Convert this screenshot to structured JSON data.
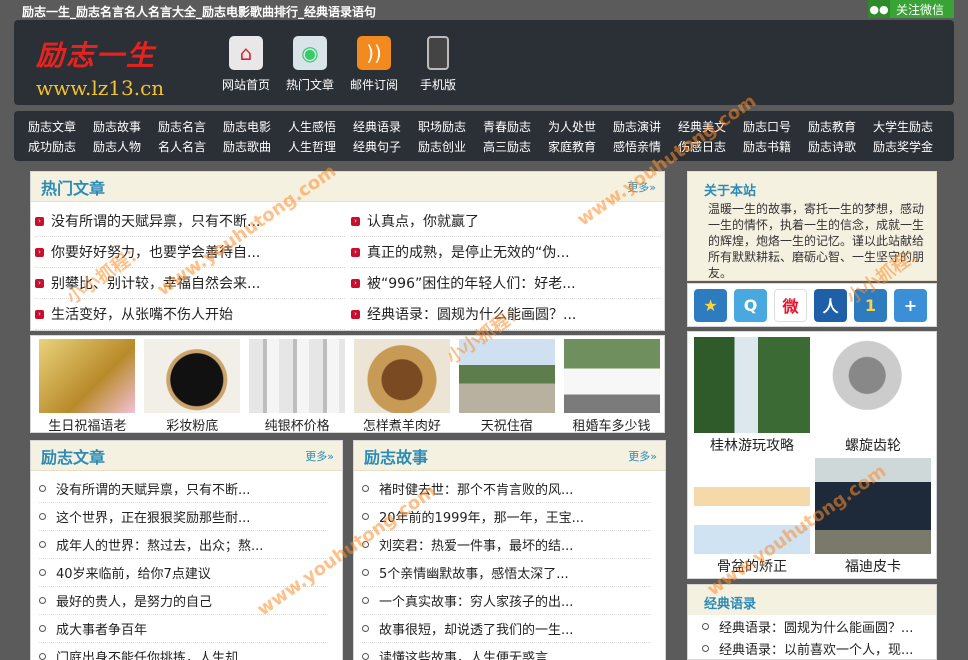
{
  "topbar": {
    "title": "励志一生_励志名言名人名言大全_励志电影歌曲排行_经典语录语句",
    "wechat": "关注微信"
  },
  "header": {
    "logo_cn": "励志一生",
    "logo_url": "www.lz13.cn",
    "nav": [
      {
        "label": "网站首页",
        "icon": "home-icon"
      },
      {
        "label": "热门文章",
        "icon": "globe-doc-icon"
      },
      {
        "label": "邮件订阅",
        "icon": "rss-icon"
      },
      {
        "label": "手机版",
        "icon": "phone-icon"
      }
    ]
  },
  "categories": {
    "row1": [
      "励志文章",
      "励志故事",
      "励志名言",
      "励志电影",
      "人生感悟",
      "经典语录",
      "职场励志",
      "青春励志",
      "为人处世",
      "励志演讲",
      "经典美文",
      "励志口号",
      "励志教育",
      "大学生励志"
    ],
    "row2": [
      "成功励志",
      "励志人物",
      "名人名言",
      "励志歌曲",
      "人生哲理",
      "经典句子",
      "励志创业",
      "高三励志",
      "家庭教育",
      "感悟亲情",
      "伤感日志",
      "励志书籍",
      "励志诗歌",
      "励志奖学金"
    ]
  },
  "hot": {
    "title": "热门文章",
    "more": "更多»",
    "items": [
      "没有所谓的天赋异禀，只有不断...",
      "认真点，你就赢了",
      "你要好好努力，也要学会善待自...",
      "真正的成熟，是停止无效的“伪...",
      "别攀比、别计较，幸福自然会来...",
      "被“996”困住的年轻人们：好老...",
      "生活变好，从张嘴不伤人开始",
      "经典语录：圆规为什么能画圆？..."
    ]
  },
  "photos": [
    "生日祝福语老",
    "彩妆粉底",
    "纯银杯价格",
    "怎样煮羊肉好",
    "天祝住宿",
    "租婚车多少钱"
  ],
  "lizhi": {
    "title": "励志文章",
    "more": "更多»",
    "items": [
      "没有所谓的天赋异禀，只有不断...",
      "这个世界，正在狠狠奖励那些耐...",
      "成年人的世界：熬过去，出众；熬...",
      "40岁来临前，给你7点建议",
      "最好的贵人，是努力的自己",
      "成大事者争百年",
      "门庭出身不能任你挑拣，人生却..."
    ]
  },
  "story": {
    "title": "励志故事",
    "more": "更多»",
    "items": [
      "褚时健去世：那个不肯言败的风...",
      "20年前的1999年，那一年，王宝...",
      "刘奕君：热爱一件事，最坏的结...",
      "5个亲情幽默故事，感悟太深了...",
      "一个真实故事：穷人家孩子的出...",
      "故事很短，却说透了我们的一生...",
      "读懂这些故事，人生便无惑言"
    ]
  },
  "about": {
    "title": "关于本站",
    "text": "温暖一生的故事，寄托一生的梦想，感动一生的情怀，执着一生的信念，成就一生的辉煌，炮烙一生的记忆。谨以此站献给所有默默耕耘、磨砺心智、一生坚守的朋友。"
  },
  "side_photos": [
    "桂林游玩攻略",
    "螺旋齿轮",
    "骨盆的矫正",
    "福迪皮卡"
  ],
  "quotes": {
    "title": "经典语录",
    "items": [
      "经典语录：圆规为什么能画圆？...",
      "经典语录：以前喜欢一个人，现..."
    ]
  },
  "watermark": "www.youhutong.com",
  "watermark_cn": "小小抓程："
}
